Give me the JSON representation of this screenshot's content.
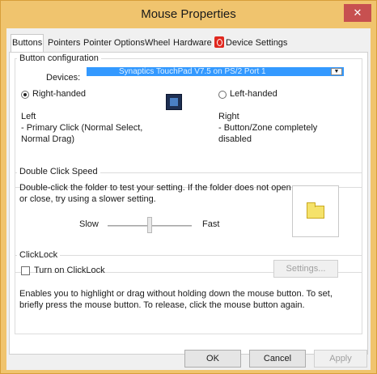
{
  "window": {
    "title": "Mouse Properties",
    "close_glyph": "✕"
  },
  "tabs": [
    {
      "label": "Buttons",
      "active": true
    },
    {
      "label": "Pointers"
    },
    {
      "label": "Pointer Options"
    },
    {
      "label": "Wheel"
    },
    {
      "label": "Hardware"
    },
    {
      "label": "Device Settings",
      "icon": "synaptics-icon"
    }
  ],
  "button_config": {
    "title": "Button configuration",
    "devices_label": "Devices:",
    "device_value": "Synaptics TouchPad V7.5 on PS/2 Port 1",
    "right_handed_label": "Right-handed",
    "right_handed_checked": true,
    "left_handed_label": "Left-handed",
    "left_handed_checked": false,
    "left_desc": "Left\n - Primary Click (Normal Select,\nNormal Drag)",
    "right_desc": "Right\n - Button/Zone completely\ndisabled"
  },
  "double_click": {
    "title": "Double Click Speed",
    "description": "Double-click the folder to test your setting.  If the folder does not open or close, try using a slower setting.",
    "slow_label": "Slow",
    "fast_label": "Fast",
    "slider_value": 0.5
  },
  "clicklock": {
    "title": "ClickLock",
    "checkbox_label": "Turn on ClickLock",
    "checked": false,
    "settings_label": "Settings...",
    "description": "Enables you to highlight or drag without holding down the mouse button.  To set, briefly press the mouse button.  To release, click the mouse button again."
  },
  "footer": {
    "ok_label": "OK",
    "cancel_label": "Cancel",
    "apply_label": "Apply"
  },
  "colors": {
    "titlebar": "#f0c46e",
    "close_button": "#c75050",
    "selection": "#3399ff"
  }
}
